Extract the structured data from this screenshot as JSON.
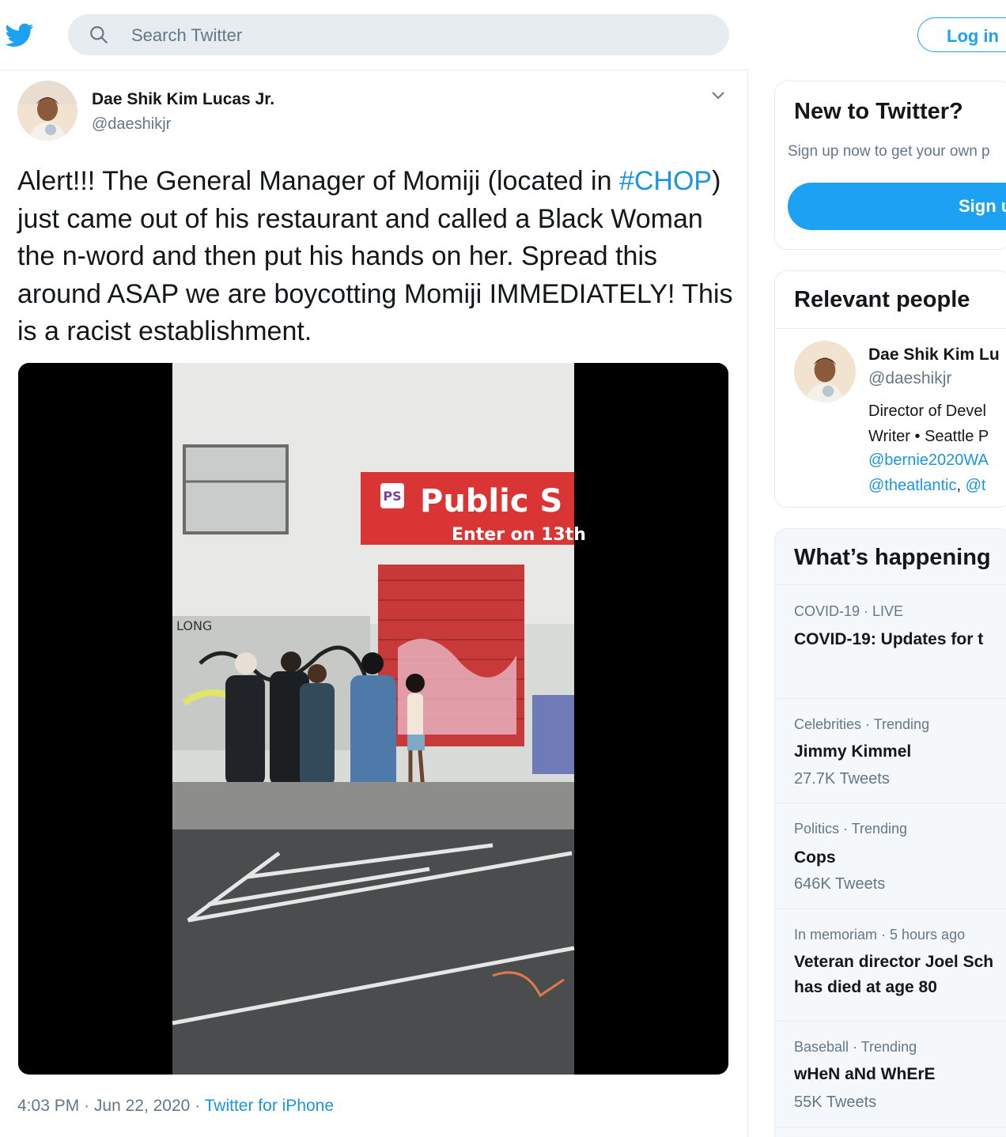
{
  "header": {
    "search_placeholder": "Search Twitter",
    "login_label": "Log in",
    "brand_color": "#1DA1F2",
    "logo_icon": "twitter-bird-icon"
  },
  "tweet": {
    "author_name": "Dae Shik Kim Lucas Jr.",
    "author_handle": "@daeshikjr",
    "text_before": "Alert!!! The General Manager of Momiji (located in ",
    "hashtag": "#CHOP",
    "text_after": ") just came out of his restaurant and called a Black Woman the n-word and then put his hands on her. Spread this around ASAP we are boycotting Momiji IMMEDIATELY! This is a racist establishment.",
    "media_signs": {
      "sign_logo": "PS",
      "sign_title": "Public S",
      "sign_subtitle": "Enter on 13th",
      "wall_text": "LONG"
    },
    "time": "4:03 PM",
    "date": "Jun 22, 2020",
    "source": "Twitter for iPhone"
  },
  "sidebar": {
    "new_to_twitter": {
      "title": "New to Twitter?",
      "subtitle": "Sign up now to get your own p",
      "signup_label": "Sign u"
    },
    "relevant_people": {
      "title": "Relevant people",
      "name": "Dae Shik Kim Lu",
      "handle": "@daeshikjr",
      "bio1": "Director of Devel",
      "bio2": "Writer • Seattle P",
      "bio3": "@bernie2020WA",
      "bio4a": "@theatlantic",
      "bio4b": ", ",
      "bio4c": "@t"
    },
    "whats_happening": {
      "title": "What’s happening",
      "trends": [
        {
          "meta": "COVID-19 · LIVE",
          "name": "COVID-19: Updates for t"
        },
        {
          "meta": "Celebrities · Trending",
          "name": "Jimmy Kimmel",
          "count": "27.7K Tweets"
        },
        {
          "meta": "Politics · Trending",
          "name": "Cops",
          "count": "646K Tweets"
        },
        {
          "meta": "In memoriam · 5 hours ago",
          "name": "Veteran director Joel Sch",
          "name2": "has died at age 80"
        },
        {
          "meta": "Baseball · Trending",
          "name": "wHeN aNd WhErE",
          "count": "55K Tweets"
        }
      ]
    }
  }
}
